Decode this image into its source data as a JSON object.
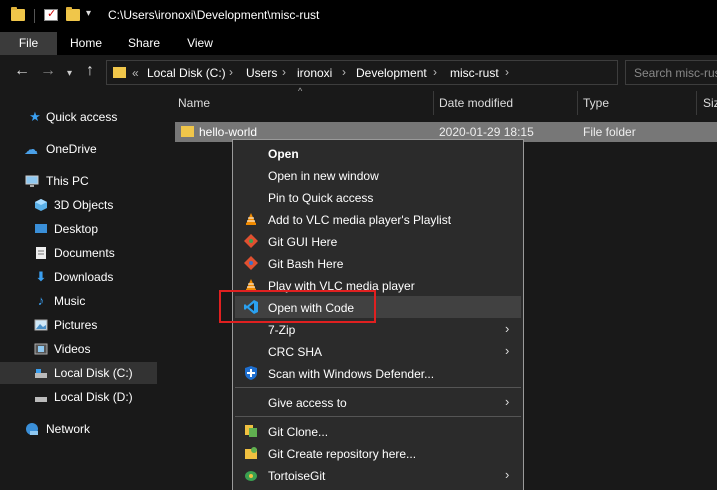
{
  "titlebar": {
    "path": "C:\\Users\\ironoxi\\Development\\misc-rust"
  },
  "ribbon": {
    "tabs": [
      "File",
      "Home",
      "Share",
      "View"
    ]
  },
  "address": {
    "overflow": "«",
    "crumbs": [
      "Local Disk (C:)",
      "Users",
      "ironoxi",
      "Development",
      "misc-rust"
    ],
    "search_placeholder": "Search misc-rust"
  },
  "nav": {
    "items": [
      {
        "label": "Quick access",
        "icon": "star-icon"
      },
      {
        "label": "OneDrive",
        "icon": "cloud-icon"
      },
      {
        "label": "This PC",
        "icon": "computer-icon"
      },
      {
        "label": "3D Objects",
        "icon": "cube-icon"
      },
      {
        "label": "Desktop",
        "icon": "desktop-icon"
      },
      {
        "label": "Documents",
        "icon": "document-icon"
      },
      {
        "label": "Downloads",
        "icon": "download-icon"
      },
      {
        "label": "Music",
        "icon": "music-icon"
      },
      {
        "label": "Pictures",
        "icon": "picture-icon"
      },
      {
        "label": "Videos",
        "icon": "video-icon"
      },
      {
        "label": "Local Disk (C:)",
        "icon": "drive-icon"
      },
      {
        "label": "Local Disk (D:)",
        "icon": "drive-icon"
      },
      {
        "label": "Network",
        "icon": "network-icon"
      }
    ]
  },
  "files": {
    "columns": [
      "Name",
      "Date modified",
      "Type",
      "Size"
    ],
    "rows": [
      {
        "name": "hello-world",
        "date": "2020-01-29 18:15",
        "type": "File folder"
      }
    ]
  },
  "context_menu": {
    "items": [
      {
        "label": "Open",
        "icon": ""
      },
      {
        "label": "Open in new window",
        "icon": ""
      },
      {
        "label": "Pin to Quick access",
        "icon": ""
      },
      {
        "label": "Add to VLC media player's Playlist",
        "icon": "vlc-icon"
      },
      {
        "label": "Git GUI Here",
        "icon": "git-gui-icon"
      },
      {
        "label": "Git Bash Here",
        "icon": "git-bash-icon"
      },
      {
        "label": "Play with VLC media player",
        "icon": "vlc-icon"
      },
      {
        "label": "Open with Code",
        "icon": "vscode-icon"
      },
      {
        "label": "7-Zip",
        "icon": ""
      },
      {
        "label": "CRC SHA",
        "icon": ""
      },
      {
        "label": "Scan with Windows Defender...",
        "icon": "defender-icon"
      },
      {
        "label": "Give access to",
        "icon": ""
      },
      {
        "label": "Git Clone...",
        "icon": "git-clone-icon"
      },
      {
        "label": "Git Create repository here...",
        "icon": "git-create-icon"
      },
      {
        "label": "TortoiseGit",
        "icon": "tortoisegit-icon"
      }
    ]
  },
  "colors": {
    "accent_highlight": "#e02020",
    "folder": "#f0c64a",
    "vscode": "#2aa0f0",
    "vlc": "#f08a00"
  }
}
